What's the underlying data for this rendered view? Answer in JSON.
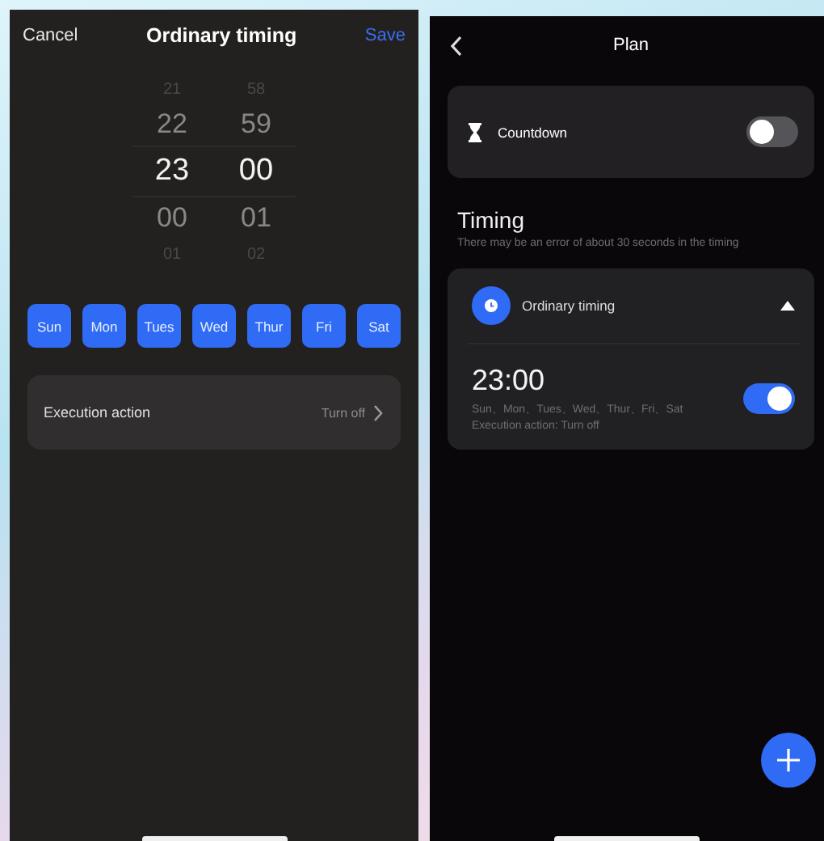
{
  "editor": {
    "cancel": "Cancel",
    "title": "Ordinary timing",
    "save": "Save",
    "picker": {
      "hours": [
        {
          "value": "21",
          "selected": false
        },
        {
          "value": "22",
          "selected": false
        },
        {
          "value": "23",
          "selected": true
        },
        {
          "value": "00",
          "selected": false
        },
        {
          "value": "01",
          "selected": false
        }
      ],
      "minutes": [
        {
          "value": "58",
          "selected": false
        },
        {
          "value": "59",
          "selected": false
        },
        {
          "value": "00",
          "selected": true
        },
        {
          "value": "01",
          "selected": false
        },
        {
          "value": "02",
          "selected": false
        }
      ]
    },
    "days": [
      {
        "label": "Sun",
        "selected": true
      },
      {
        "label": "Mon",
        "selected": true
      },
      {
        "label": "Tues",
        "selected": true
      },
      {
        "label": "Wed",
        "selected": true
      },
      {
        "label": "Thur",
        "selected": true
      },
      {
        "label": "Fri",
        "selected": true
      },
      {
        "label": "Sat",
        "selected": true
      }
    ],
    "action": {
      "label": "Execution action",
      "value": "Turn off"
    }
  },
  "plan": {
    "title": "Plan",
    "countdown": {
      "label": "Countdown",
      "on": false
    },
    "section": {
      "title": "Timing",
      "note": "There may be an error of about 30 seconds in the timing"
    },
    "timers": [
      {
        "title": "Ordinary timing",
        "expanded": true,
        "time": "23:00",
        "days": "Sun、Mon、Tues、Wed、Thur、Fri、Sat",
        "action": "Execution action: Turn off",
        "on": true
      }
    ]
  }
}
